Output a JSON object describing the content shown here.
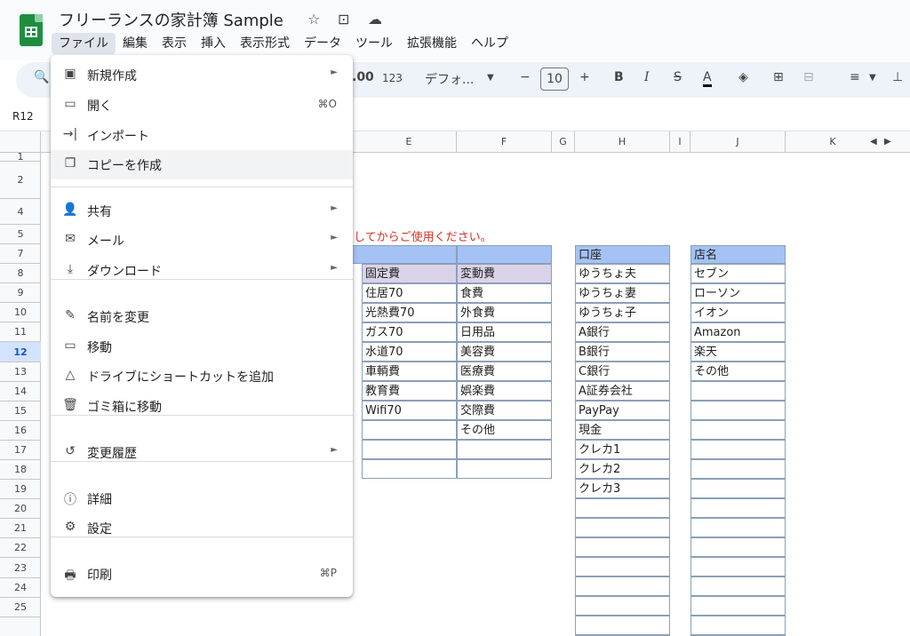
{
  "doc_title": "フリーランスの家計簿  Sample",
  "menu": [
    "ファイル",
    "編集",
    "表示",
    "挿入",
    "表示形式",
    "データ",
    "ツール",
    "拡張機能",
    "ヘルプ"
  ],
  "toolbar": {
    "decimal": ".00",
    "number_format": "123",
    "font": "デフォ...",
    "font_size": "10",
    "bold": "B",
    "italic": "I",
    "strike": "S",
    "text_color": "A"
  },
  "name_box": "R12",
  "columns": [
    "E",
    "F",
    "G",
    "H",
    "I",
    "J",
    "K"
  ],
  "rows": [
    "1",
    "2",
    "4",
    "5",
    "7",
    "8",
    "9",
    "10",
    "11",
    "12",
    "13",
    "14",
    "15",
    "16",
    "17",
    "18",
    "19",
    "20",
    "21",
    "22",
    "23",
    "24",
    "25"
  ],
  "notice": "してからご使用ください。",
  "tables": {
    "fixed_header": "固定費",
    "variable_header": "変動費",
    "fixed": [
      "住居70",
      "光熱費70",
      "ガス70",
      "水道70",
      "車輌費",
      "教育費",
      "Wifi70"
    ],
    "variable": [
      "食費",
      "外食費",
      "日用品",
      "美容費",
      "医療費",
      "娯楽費",
      "交際費",
      "その他"
    ],
    "account_header": "口座",
    "accounts": [
      "ゆうちょ夫",
      "ゆうちょ妻",
      "ゆうちょ子",
      "A銀行",
      "B銀行",
      "C銀行",
      "A証券会社",
      "PayPay",
      "現金",
      "クレカ1",
      "クレカ2",
      "クレカ3"
    ],
    "store_header": "店名",
    "stores": [
      "セブン",
      "ローソン",
      "イオン",
      "Amazon",
      "楽天",
      "その他"
    ]
  },
  "file_menu": [
    {
      "label": "新規作成",
      "icon": "new-icon",
      "arrow": "►"
    },
    {
      "label": "開く",
      "icon": "folder-icon",
      "shortcut": "⌘O"
    },
    {
      "label": "インポート",
      "icon": "import-icon"
    },
    {
      "label": "コピーを作成",
      "icon": "copy-icon"
    },
    {
      "label": "共有",
      "icon": "share-icon",
      "arrow": "►"
    },
    {
      "label": "メール",
      "icon": "mail-icon",
      "arrow": "►"
    },
    {
      "label": "ダウンロード",
      "icon": "download-icon",
      "arrow": "►"
    },
    {
      "label": "名前を変更",
      "icon": "rename-icon"
    },
    {
      "label": "移動",
      "icon": "move-icon"
    },
    {
      "label": "ドライブにショートカットを追加",
      "icon": "drive-shortcut-icon"
    },
    {
      "label": "ゴミ箱に移動",
      "icon": "trash-icon"
    },
    {
      "label": "変更履歴",
      "icon": "history-icon",
      "arrow": "►"
    },
    {
      "label": "詳細",
      "icon": "info-icon"
    },
    {
      "label": "設定",
      "icon": "gear-icon"
    },
    {
      "label": "印刷",
      "icon": "print-icon",
      "shortcut": "⌘P"
    }
  ],
  "colors": {
    "header_blue": "#a4c2f4",
    "header_purple": "#d9d2e9",
    "notice_red": "#d93025",
    "highlight": "#f1f3f4"
  }
}
